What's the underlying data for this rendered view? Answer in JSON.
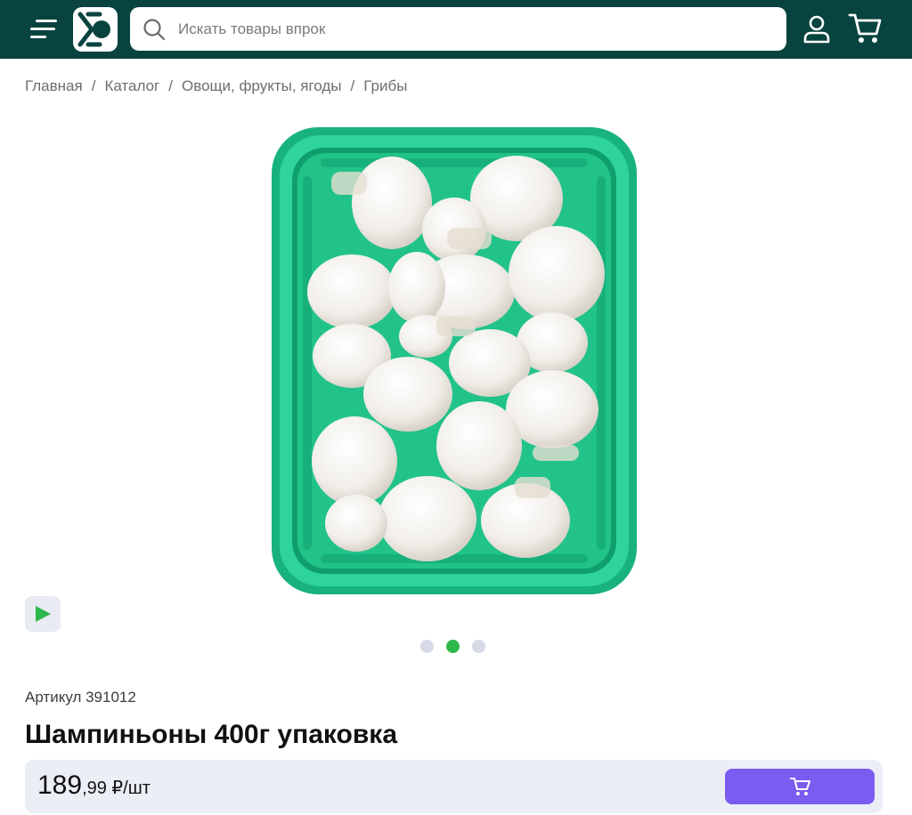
{
  "header": {
    "search_placeholder": "Искать товары впрок",
    "colors": {
      "background": "#08433f",
      "accent": "#7a5cf0",
      "active_dot": "#2db84b"
    },
    "icons": [
      "menu-icon",
      "logo",
      "search-icon",
      "user-icon",
      "cart-icon"
    ]
  },
  "breadcrumbs": [
    "Главная",
    "Каталог",
    "Овощи, фрукты, ягоды",
    "Грибы"
  ],
  "breadcrumb_separator": "/",
  "gallery": {
    "image_description": "mushrooms",
    "slides_count": 3,
    "active_slide": 2,
    "video_button_icon": "play-icon"
  },
  "product": {
    "sku_label": "Артикул 391012",
    "title": "Шампиньоны 400г упаковка",
    "price_int": "189",
    "price_dec": ",99 ₽/шт",
    "add_to_cart_icon": "cart-icon"
  }
}
